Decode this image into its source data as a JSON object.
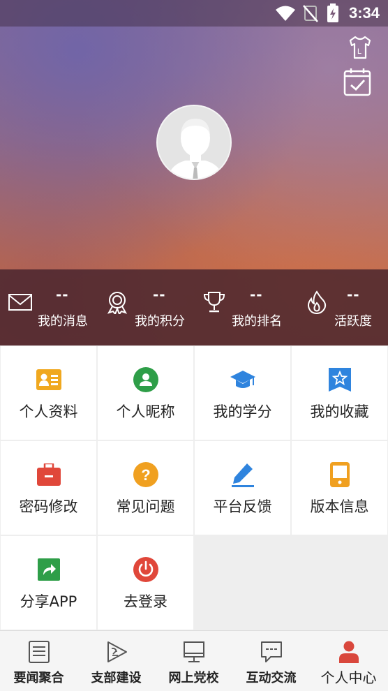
{
  "status_bar": {
    "time": "3:34"
  },
  "stats": [
    {
      "value": "--",
      "label": "我的消息",
      "icon": "mail-icon"
    },
    {
      "value": "--",
      "label": "我的积分",
      "icon": "medal-icon"
    },
    {
      "value": "--",
      "label": "我的排名",
      "icon": "trophy-icon"
    },
    {
      "value": "--",
      "label": "活跃度",
      "icon": "flame-icon"
    }
  ],
  "menu": [
    {
      "label": "个人资料",
      "icon": "id-card-icon",
      "color": "#f0a81f"
    },
    {
      "label": "个人昵称",
      "icon": "user-circle-icon",
      "color": "#2e9e48"
    },
    {
      "label": "我的学分",
      "icon": "graduation-cap-icon",
      "color": "#2f84de"
    },
    {
      "label": "我的收藏",
      "icon": "star-bookmark-icon",
      "color": "#2f84de"
    },
    {
      "label": "密码修改",
      "icon": "briefcase-icon",
      "color": "#e0473a"
    },
    {
      "label": "常见问题",
      "icon": "question-icon",
      "color": "#f0a020"
    },
    {
      "label": "平台反馈",
      "icon": "pencil-icon",
      "color": "#2f84de"
    },
    {
      "label": "版本信息",
      "icon": "phone-icon",
      "color": "#f0a020"
    },
    {
      "label": "分享APP",
      "icon": "share-icon",
      "color": "#2e9e48"
    },
    {
      "label": "去登录",
      "icon": "power-icon",
      "color": "#e0473a"
    }
  ],
  "bottom_nav": [
    {
      "label": "要闻聚合",
      "icon": "news-icon"
    },
    {
      "label": "支部建设",
      "icon": "party-play-icon"
    },
    {
      "label": "网上党校",
      "icon": "monitor-icon"
    },
    {
      "label": "互动交流",
      "icon": "chat-icon"
    },
    {
      "label": "个人中心",
      "icon": "person-icon",
      "active_color": "#d9473c"
    }
  ]
}
